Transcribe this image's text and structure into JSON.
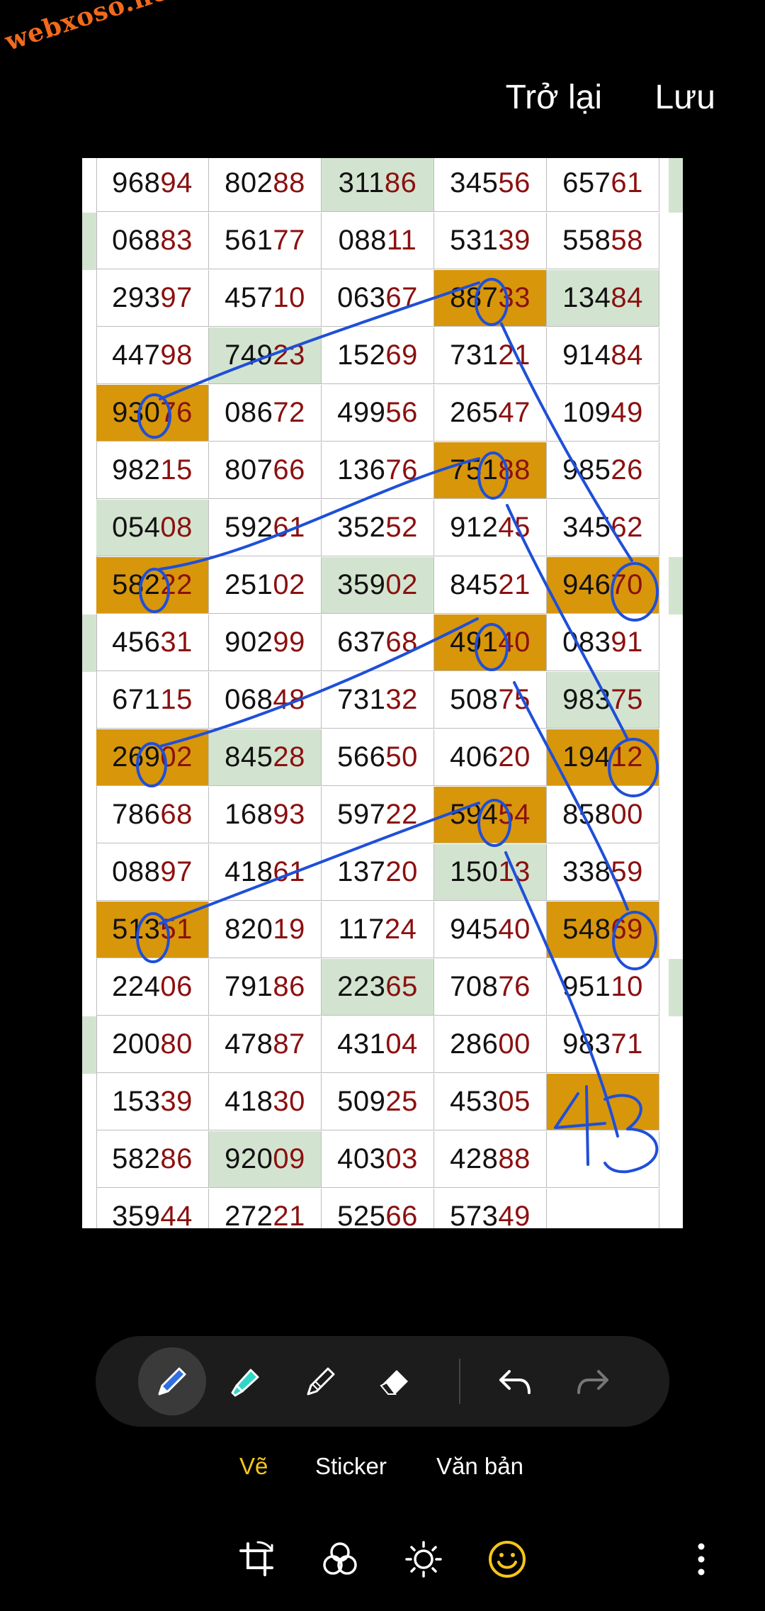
{
  "watermark": "webxoso.net",
  "header": {
    "back_label": "Trở lại",
    "save_label": "Lưu"
  },
  "sheet": {
    "rows": [
      [
        [
          "968",
          "94",
          "white"
        ],
        [
          "802",
          "88",
          "white"
        ],
        [
          "311",
          "86",
          "green"
        ],
        [
          "345",
          "56",
          "white"
        ],
        [
          "657",
          "61",
          "white"
        ]
      ],
      [
        [
          "068",
          "83",
          "white"
        ],
        [
          "561",
          "77",
          "white"
        ],
        [
          "088",
          "11",
          "white"
        ],
        [
          "531",
          "39",
          "white"
        ],
        [
          "558",
          "58",
          "white"
        ]
      ],
      [
        [
          "293",
          "97",
          "white"
        ],
        [
          "457",
          "10",
          "white"
        ],
        [
          "063",
          "67",
          "white"
        ],
        [
          "887",
          "33",
          "orange"
        ],
        [
          "134",
          "84",
          "green"
        ]
      ],
      [
        [
          "447",
          "98",
          "white"
        ],
        [
          "749",
          "23",
          "green"
        ],
        [
          "152",
          "69",
          "white"
        ],
        [
          "731",
          "21",
          "white"
        ],
        [
          "914",
          "84",
          "white"
        ]
      ],
      [
        [
          "930",
          "76",
          "orange"
        ],
        [
          "086",
          "72",
          "white"
        ],
        [
          "499",
          "56",
          "white"
        ],
        [
          "265",
          "47",
          "white"
        ],
        [
          "109",
          "49",
          "white"
        ]
      ],
      [
        [
          "982",
          "15",
          "white"
        ],
        [
          "807",
          "66",
          "white"
        ],
        [
          "136",
          "76",
          "white"
        ],
        [
          "751",
          "88",
          "orange"
        ],
        [
          "985",
          "26",
          "white"
        ]
      ],
      [
        [
          "054",
          "08",
          "green"
        ],
        [
          "592",
          "61",
          "white"
        ],
        [
          "352",
          "52",
          "white"
        ],
        [
          "912",
          "45",
          "white"
        ],
        [
          "345",
          "62",
          "white"
        ]
      ],
      [
        [
          "582",
          "22",
          "orange"
        ],
        [
          "251",
          "02",
          "white"
        ],
        [
          "359",
          "02",
          "green"
        ],
        [
          "845",
          "21",
          "white"
        ],
        [
          "946",
          "70",
          "orange"
        ]
      ],
      [
        [
          "456",
          "31",
          "white"
        ],
        [
          "902",
          "99",
          "white"
        ],
        [
          "637",
          "68",
          "white"
        ],
        [
          "491",
          "40",
          "orange"
        ],
        [
          "083",
          "91",
          "white"
        ]
      ],
      [
        [
          "671",
          "15",
          "white"
        ],
        [
          "068",
          "48",
          "white"
        ],
        [
          "731",
          "32",
          "white"
        ],
        [
          "508",
          "75",
          "white"
        ],
        [
          "983",
          "75",
          "green"
        ]
      ],
      [
        [
          "269",
          "02",
          "orange"
        ],
        [
          "845",
          "28",
          "green"
        ],
        [
          "566",
          "50",
          "white"
        ],
        [
          "406",
          "20",
          "white"
        ],
        [
          "194",
          "12",
          "orange"
        ]
      ],
      [
        [
          "786",
          "68",
          "white"
        ],
        [
          "168",
          "93",
          "white"
        ],
        [
          "597",
          "22",
          "white"
        ],
        [
          "594",
          "54",
          "orange"
        ],
        [
          "858",
          "00",
          "white"
        ]
      ],
      [
        [
          "088",
          "97",
          "white"
        ],
        [
          "418",
          "61",
          "white"
        ],
        [
          "137",
          "20",
          "white"
        ],
        [
          "150",
          "13",
          "green"
        ],
        [
          "338",
          "59",
          "white"
        ]
      ],
      [
        [
          "513",
          "51",
          "orange"
        ],
        [
          "820",
          "19",
          "white"
        ],
        [
          "117",
          "24",
          "white"
        ],
        [
          "945",
          "40",
          "white"
        ],
        [
          "548",
          "69",
          "orange"
        ]
      ],
      [
        [
          "224",
          "06",
          "white"
        ],
        [
          "791",
          "86",
          "white"
        ],
        [
          "223",
          "65",
          "green"
        ],
        [
          "708",
          "76",
          "white"
        ],
        [
          "951",
          "10",
          "white"
        ]
      ],
      [
        [
          "200",
          "80",
          "white"
        ],
        [
          "478",
          "87",
          "white"
        ],
        [
          "431",
          "04",
          "white"
        ],
        [
          "286",
          "00",
          "white"
        ],
        [
          "983",
          "71",
          "white"
        ]
      ],
      [
        [
          "153",
          "39",
          "white"
        ],
        [
          "418",
          "30",
          "white"
        ],
        [
          "509",
          "25",
          "white"
        ],
        [
          "453",
          "05",
          "white"
        ],
        [
          "",
          "",
          "orange"
        ]
      ],
      [
        [
          "582",
          "86",
          "white"
        ],
        [
          "920",
          "09",
          "green"
        ],
        [
          "403",
          "03",
          "white"
        ],
        [
          "428",
          "88",
          "white"
        ],
        [
          "",
          "",
          "white"
        ]
      ],
      [
        [
          "359",
          "44",
          "white"
        ],
        [
          "272",
          "21",
          "white"
        ],
        [
          "525",
          "66",
          "white"
        ],
        [
          "573",
          "49",
          "white"
        ],
        [
          "",
          "",
          "white"
        ]
      ]
    ],
    "left_edge_green_rows": [
      1,
      8,
      15
    ],
    "right_edge_green_rows": [
      0,
      7,
      14
    ],
    "handwritten_note": "43",
    "ink_color": "#1f4fd8",
    "highlight_color": "#d8960b",
    "green_color": "#d2e4cf"
  },
  "toolbar": {
    "tools": [
      {
        "icon": "pen-icon",
        "active": true
      },
      {
        "icon": "highlighter-icon",
        "active": false
      },
      {
        "icon": "pencil-icon",
        "active": false
      },
      {
        "icon": "eraser-icon",
        "active": false
      }
    ],
    "undo_icon": "undo-icon",
    "redo_icon": "redo-icon"
  },
  "tabs": [
    {
      "label": "Vẽ",
      "active": true
    },
    {
      "label": "Sticker",
      "active": false
    },
    {
      "label": "Văn bản",
      "active": false
    }
  ],
  "bottom_nav": [
    "crop-rotate-icon",
    "filter-icon",
    "brightness-icon",
    "emoji-icon",
    "more-icon"
  ]
}
